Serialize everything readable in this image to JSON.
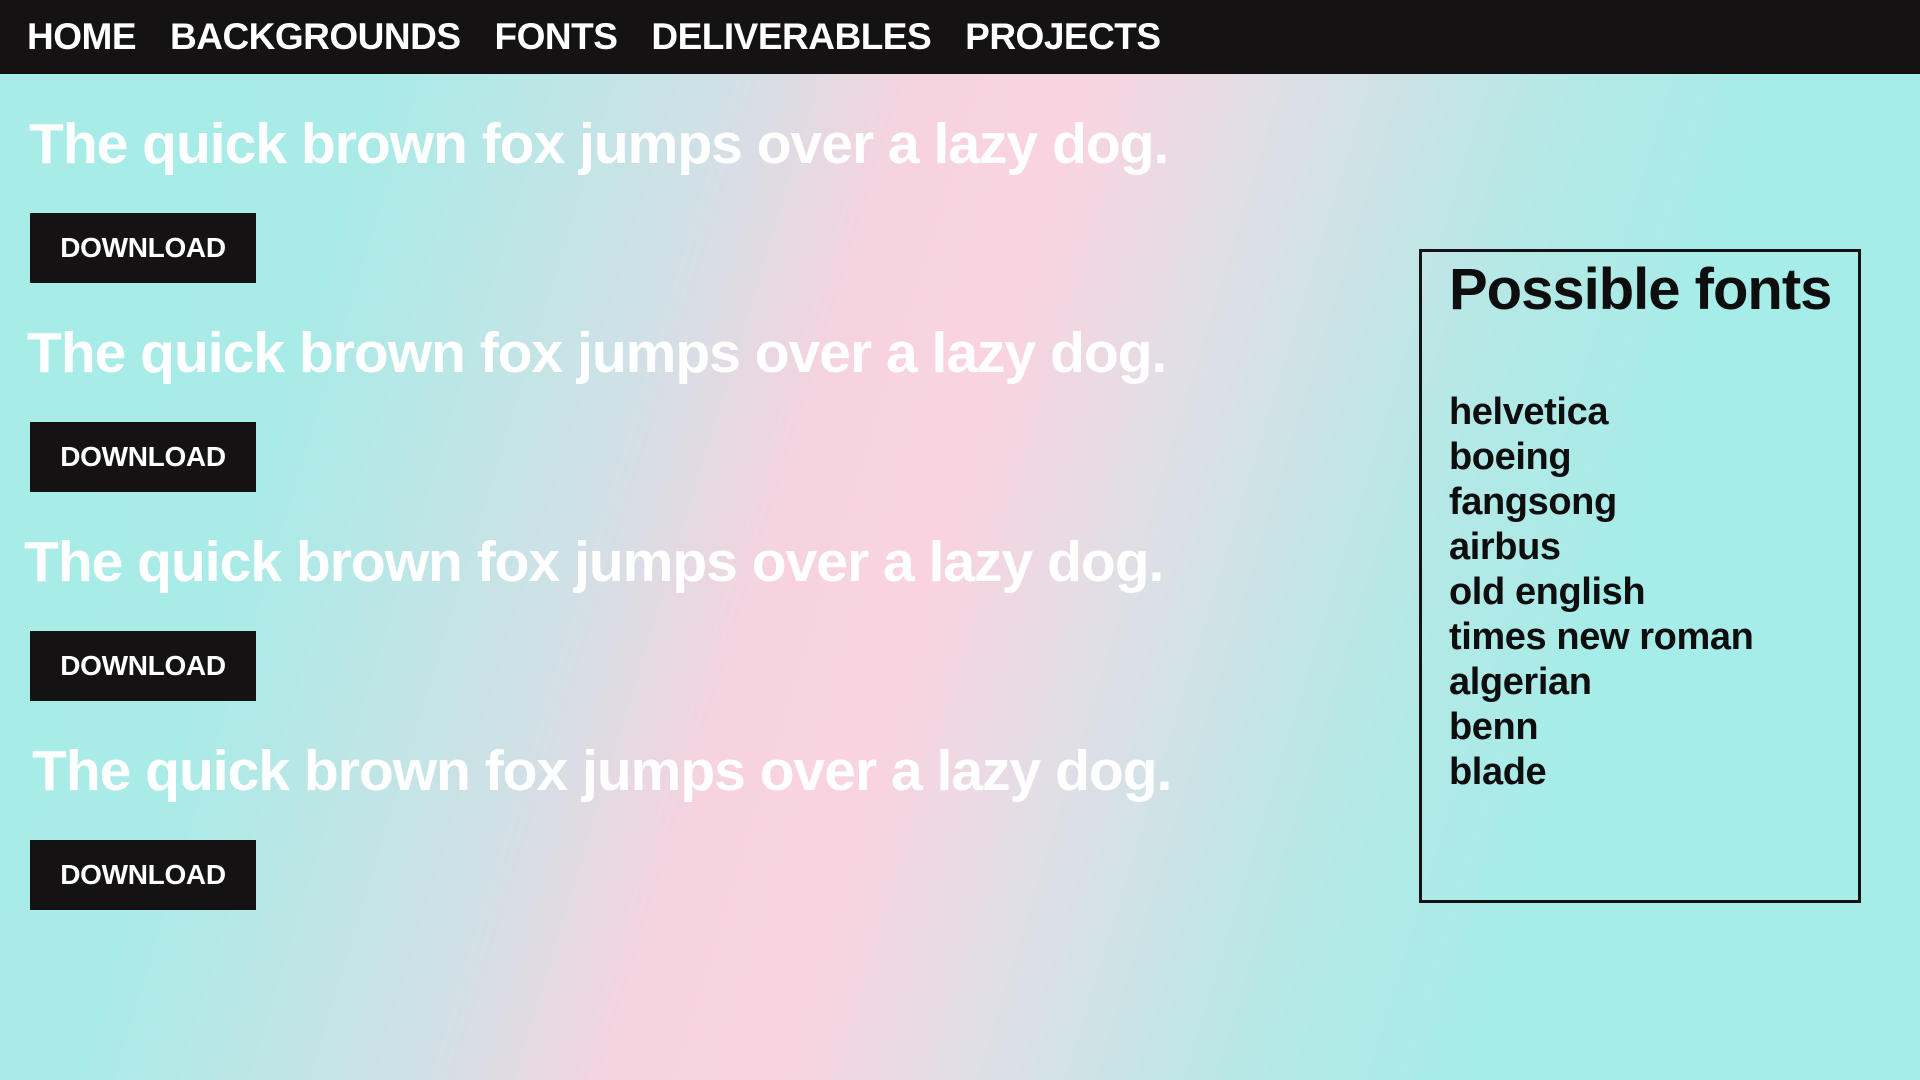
{
  "nav": {
    "items": [
      {
        "label": "HOME"
      },
      {
        "label": "BACKGROUNDS"
      },
      {
        "label": "FONTS"
      },
      {
        "label": "DELIVERABLES"
      },
      {
        "label": "PROJECTS"
      }
    ]
  },
  "samples": [
    {
      "text": "The quick brown fox jumps over a lazy dog.",
      "button_label": "DOWNLOAD"
    },
    {
      "text": "The quick brown fox jumps over a lazy dog.",
      "button_label": "DOWNLOAD"
    },
    {
      "text": "The quick brown fox jumps over a lazy dog.",
      "button_label": "DOWNLOAD"
    },
    {
      "text": "The quick brown fox jumps over a lazy dog.",
      "button_label": "DOWNLOAD"
    }
  ],
  "fonts_panel": {
    "title": "Possible fonts",
    "fonts": [
      "helvetica",
      "boeing",
      "fangsong",
      "airbus",
      "old english",
      "times new roman",
      "algerian",
      "benn",
      "blade"
    ]
  },
  "colors": {
    "nav_background": "#141213",
    "button_background": "#141213",
    "gradient_aqua": "#a7ece8",
    "gradient_pink": "#fad3e0"
  }
}
